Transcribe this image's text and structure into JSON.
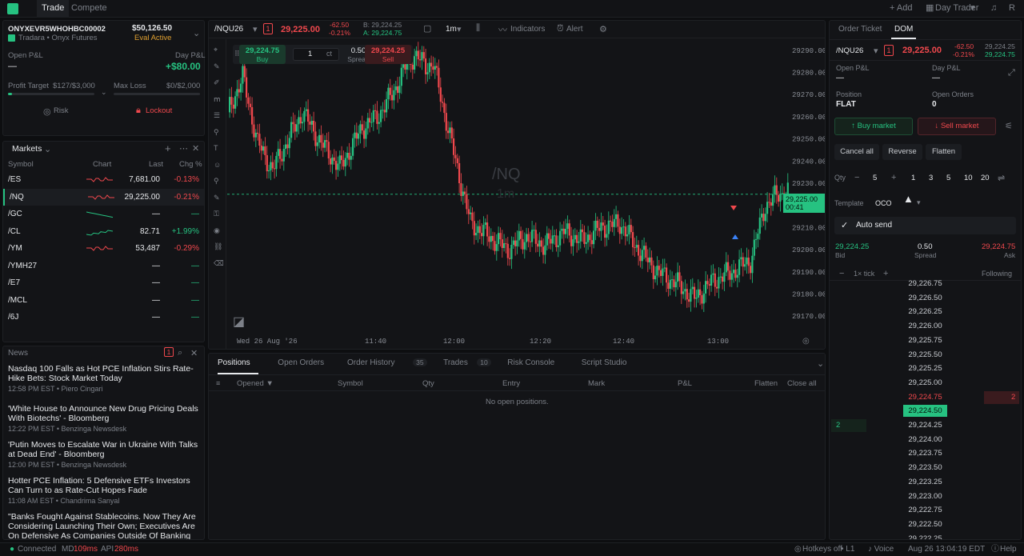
{
  "topbar": {
    "tab_trade": "Trade",
    "tab_compete": "Compete",
    "add": "+ Add",
    "layout": "Day Trader",
    "avatar": "R"
  },
  "account": {
    "id": "ONYXEVR5WHOHBC00002",
    "firm": "Tradara",
    "sub": "Onyx Futures",
    "balance": "$50,126.50",
    "status": "Eval Active",
    "open_pnl_label": "Open P&L",
    "open_pnl": "—",
    "day_pnl_label": "Day P&L",
    "day_pnl": "+$80.00",
    "profit_target_label": "Profit Target",
    "profit_target": "$127/$3,000",
    "profit_progress": 0.042,
    "max_loss_label": "Max Loss",
    "max_loss": "$0/$2,000",
    "risk": "Risk",
    "lockout": "Lockout"
  },
  "markets": {
    "title": "Markets",
    "cols": [
      "Symbol",
      "Chart",
      "Last",
      "Chg %"
    ],
    "rows": [
      {
        "sym": "/ES",
        "last": "7,681.00",
        "chg": "-0.13%",
        "dir": "down"
      },
      {
        "sym": "/NQ",
        "last": "29,225.00",
        "chg": "-0.21%",
        "dir": "down"
      },
      {
        "sym": "/GC",
        "last": "—",
        "chg": "—",
        "dir": "flat"
      },
      {
        "sym": "/CL",
        "last": "82.71",
        "chg": "+1.99%",
        "dir": "up"
      },
      {
        "sym": "/YM",
        "last": "53,487",
        "chg": "-0.29%",
        "dir": "down"
      },
      {
        "sym": "/YMH27",
        "last": "—",
        "chg": "—",
        "dir": "none"
      },
      {
        "sym": "/E7",
        "last": "—",
        "chg": "—",
        "dir": "none"
      },
      {
        "sym": "/MCL",
        "last": "—",
        "chg": "—",
        "dir": "none"
      },
      {
        "sym": "/6J",
        "last": "—",
        "chg": "—",
        "dir": "none"
      }
    ]
  },
  "news": {
    "title": "News",
    "badge": "1",
    "items": [
      {
        "title": "Nasdaq 100 Falls as Hot PCE Inflation Stirs Rate-Hike Bets: Stock Market Today",
        "time": "12:58 PM EST",
        "src": "Piero Cingari"
      },
      {
        "title": "'White House to Announce New Drug Pricing Deals With Biotechs' - Bloomberg",
        "time": "12:22 PM EST",
        "src": "Benzinga Newsdesk"
      },
      {
        "title": "'Putin Moves to Escalate War in Ukraine With Talks at Dead End' - Bloomberg",
        "time": "12:00 PM EST",
        "src": "Benzinga Newsdesk"
      },
      {
        "title": "Hotter PCE Inflation: 5 Defensive ETFs Investors Can Turn to as Rate-Cut Hopes Fade",
        "time": "11:08 AM EST",
        "src": "Chandrima Sanyal"
      },
      {
        "title": "\"Banks Fought Against Stablecoins. Now They Are Considering Launching Their Own; Executives Are On Defensive As Companies Outside Of Banking System...",
        "time": "",
        "src": ""
      }
    ]
  },
  "chart": {
    "symbol": "/NQU26",
    "qty_badge": "1",
    "price": "29,225.00",
    "chg": "-62.50",
    "chg_pct": "-0.21%",
    "bid": "B: 29,224.25",
    "ask": "A: 29,224.75",
    "interval": "1m",
    "indicators": "Indicators",
    "alert": "Alert",
    "buy_price": "29,224.75",
    "buy": "Buy",
    "qty": "1",
    "qty_unit": "ct",
    "spread": "0.50",
    "spread_label": "Spread",
    "sell_price": "29,224.25",
    "sell": "Sell",
    "watermark": "/NQ",
    "watermark2": "1m",
    "last_tag": "29,225.00",
    "last_timer": "00:41",
    "y_ticks": [
      "29290.00",
      "29280.00",
      "29270.00",
      "29260.00",
      "29250.00",
      "29240.00",
      "29230.00",
      "29220.00",
      "29210.00",
      "29200.00",
      "29190.00",
      "29180.00",
      "29170.00"
    ],
    "x_ticks": [
      "Wed 26 Aug '26",
      "11:40",
      "12:00",
      "12:20",
      "12:40",
      "13:00"
    ]
  },
  "chart_data": {
    "type": "candlestick",
    "symbol": "/NQU26",
    "interval": "1m",
    "y_range": [
      29165,
      29295
    ],
    "last": 29225.0,
    "x_ticks": [
      "Wed 26 Aug '26",
      "11:40",
      "12:00",
      "12:20",
      "12:40",
      "13:00"
    ],
    "y_ticks": [
      29290,
      29280,
      29270,
      29260,
      29250,
      29240,
      29230,
      29220,
      29210,
      29200,
      29190,
      29180,
      29170
    ]
  },
  "positions": {
    "tabs": [
      "Positions",
      "Open Orders",
      "Order History",
      "Trades",
      "Risk Console",
      "Script Studio"
    ],
    "tab_counts": [
      "",
      "",
      "35",
      "10",
      "",
      ""
    ],
    "cols": [
      "Opened ▼",
      "Symbol",
      "Qty",
      "Entry",
      "Mark",
      "P&L"
    ],
    "flatten": "Flatten",
    "close_all": "Close all",
    "empty": "No open positions."
  },
  "dom": {
    "tab_ticket": "Order Ticket",
    "tab_dom": "DOM",
    "symbol": "/NQU26",
    "badge": "1",
    "price": "29,225.00",
    "chg": "-62.50",
    "chg_pct": "-0.21%",
    "bid": "29,224.25",
    "ask": "29,224.75",
    "open_pnl_label": "Open P&L",
    "open_pnl": "—",
    "day_pnl_label": "Day P&L",
    "day_pnl": "—",
    "position_label": "Position",
    "position": "FLAT",
    "open_orders_label": "Open Orders",
    "open_orders": "0",
    "buy_market": "Buy market",
    "sell_market": "Sell market",
    "cancel_all": "Cancel all",
    "reverse": "Reverse",
    "flatten": "Flatten",
    "qty_label": "Qty",
    "qty": "5",
    "qty_presets": [
      "1",
      "3",
      "5",
      "10",
      "20"
    ],
    "template_label": "Template",
    "template": "OCO",
    "auto_send": "Auto send",
    "bid_label": "Bid",
    "spread": "0.50",
    "spread_label": "Spread",
    "ask_label": "Ask",
    "tick_label": "1× tick",
    "following": "Following",
    "ladder": [
      "29,226.75",
      "29,226.50",
      "29,226.25",
      "29,226.00",
      "29,225.75",
      "29,225.50",
      "29,225.25",
      "29,225.00",
      "29,224.75",
      "29,224.50",
      "29,224.25",
      "29,224.00",
      "29,223.75",
      "29,223.50",
      "29,223.25",
      "29,223.00",
      "29,222.75",
      "29,222.50",
      "29,222.25"
    ],
    "ask_size": "2",
    "bid_size": "2"
  },
  "status": {
    "connected": "Connected",
    "md_label": "MD",
    "md": "109ms",
    "api_label": "API",
    "api": "280ms",
    "hotkeys": "Hotkeys off",
    "level": "L1",
    "voice": "Voice",
    "time": "Aug 26 13:04:19 EDT",
    "help": "Help"
  }
}
